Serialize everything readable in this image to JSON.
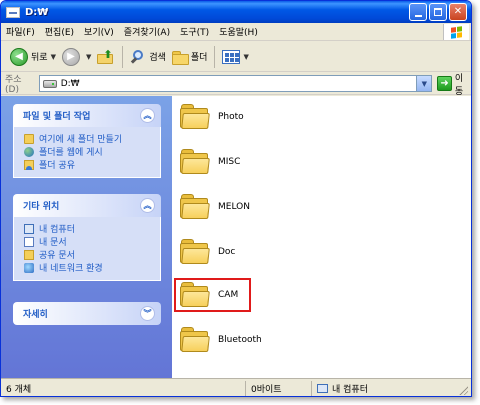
{
  "window": {
    "title": "D:₩"
  },
  "menu": [
    "파일(F)",
    "편집(E)",
    "보기(V)",
    "즐겨찾기(A)",
    "도구(T)",
    "도움말(H)"
  ],
  "toolbar": {
    "back_label": "뒤로",
    "search_label": "검색",
    "folders_label": "폴더"
  },
  "address": {
    "label": "주소(D)",
    "value": "D:₩",
    "go_label": "이동"
  },
  "tasks": {
    "file_folder": {
      "title": "파일 및 폴더 작업",
      "items": [
        "여기에 새 폴더 만들기",
        "폴더를 웹에 게시",
        "폴더 공유"
      ]
    },
    "other_places": {
      "title": "기타 위치",
      "items": [
        "내 컴퓨터",
        "내 문서",
        "공유 문서",
        "내 네트워크 환경"
      ]
    },
    "details": {
      "title": "자세히"
    }
  },
  "files": [
    "Photo",
    "MISC",
    "MELON",
    "Doc",
    "CAM",
    "Bluetooth"
  ],
  "selected_file": "CAM",
  "status": {
    "count": "6 개체",
    "size": "0바이트",
    "zone": "내 컴퓨터"
  }
}
